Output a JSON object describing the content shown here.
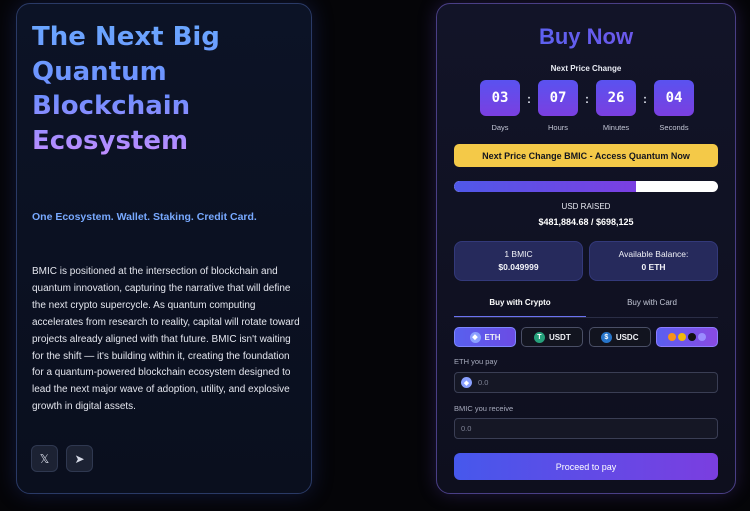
{
  "hero": {
    "title_lines": [
      "The Next Big",
      "Quantum",
      "Blockchain",
      "Ecosystem"
    ],
    "tagline": "One Ecosystem. Wallet. Staking. Credit Card.",
    "description": "BMIC is positioned at the intersection of blockchain and quantum innovation, capturing the narrative that will define the next crypto supercycle. As quantum computing accelerates from research to reality, capital will rotate toward projects already aligned with that future. BMIC isn't waiting for the shift — it's building within it, creating the foundation for a quantum-powered blockchain ecosystem designed to lead the next major wave of adoption, utility, and explosive growth in digital assets.",
    "socials": [
      {
        "icon": "x-icon",
        "glyph": "𝕏"
      },
      {
        "icon": "telegram-icon",
        "glyph": "➤"
      }
    ]
  },
  "buy": {
    "title": "Buy Now",
    "next_price_label": "Next Price Change",
    "countdown": [
      {
        "value": "03",
        "label": "Days"
      },
      {
        "value": "07",
        "label": "Hours"
      },
      {
        "value": "26",
        "label": "Minutes"
      },
      {
        "value": "04",
        "label": "Seconds"
      }
    ],
    "banner": "Next Price Change BMIC - Access Quantum Now",
    "progress_fraction": 0.691,
    "raised_label": "USD RAISED",
    "raised_value": "$481,884.68 / $698,125",
    "price_box": {
      "label": "1 BMIC",
      "value": "$0.049999"
    },
    "balance_box": {
      "label": "Available Balance:",
      "value": "0 ETH"
    },
    "tabs": [
      {
        "label": "Buy with Crypto",
        "active": true
      },
      {
        "label": "Buy with Card",
        "active": false
      }
    ],
    "currencies": [
      {
        "label": "ETH",
        "icon": "eth-icon",
        "glyph": "◆",
        "active": true
      },
      {
        "label": "USDT",
        "icon": "usdt-icon",
        "glyph": "T",
        "active": false
      },
      {
        "label": "USDC",
        "icon": "usdc-icon",
        "glyph": "$",
        "active": false
      }
    ],
    "pay_label": "ETH you pay",
    "pay_placeholder": "0.0",
    "receive_label": "BMIC you receive",
    "receive_placeholder": "0.0",
    "proceed": "Proceed to pay",
    "colors": {
      "accent": "#6a4ce6",
      "banner": "#f4c948"
    }
  }
}
